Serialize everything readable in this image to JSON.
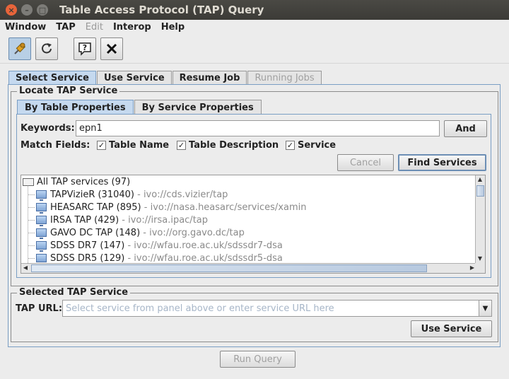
{
  "window": {
    "title": "Table Access Protocol (TAP) Query"
  },
  "menu": {
    "window": "Window",
    "tap": "TAP",
    "edit": "Edit",
    "interop": "Interop",
    "help": "Help"
  },
  "tabs": {
    "select_service": "Select Service",
    "use_service": "Use Service",
    "resume_job": "Resume Job",
    "running_jobs": "Running Jobs"
  },
  "locate": {
    "title": "Locate TAP Service",
    "subtabs": {
      "by_table": "By Table Properties",
      "by_service": "By Service Properties"
    },
    "keywords_label": "Keywords:",
    "keywords_value": "epn1",
    "and_button": "And",
    "match_fields_label": "Match Fields:",
    "match_fields": [
      {
        "label": "Table Name",
        "checked": true
      },
      {
        "label": "Table Description",
        "checked": true
      },
      {
        "label": "Service",
        "checked": true
      }
    ],
    "cancel_button": "Cancel",
    "find_button": "Find Services",
    "tree": {
      "root": "All TAP services (97)",
      "items": [
        {
          "name": "TAPVizieR (31040)",
          "id": "- ivo://cds.vizier/tap"
        },
        {
          "name": "HEASARC TAP (895)",
          "id": "- ivo://nasa.heasarc/services/xamin"
        },
        {
          "name": "IRSA TAP (429)",
          "id": "- ivo://irsa.ipac/tap"
        },
        {
          "name": "GAVO DC TAP (148)",
          "id": "- ivo://org.gavo.dc/tap"
        },
        {
          "name": "SDSS DR7 (147)",
          "id": "- ivo://wfau.roe.ac.uk/sdssdr7-dsa"
        },
        {
          "name": "SDSS DR5 (129)",
          "id": "- ivo://wfau.roe.ac.uk/sdssdr5-dsa"
        }
      ]
    }
  },
  "selected": {
    "title": "Selected TAP Service",
    "url_label": "TAP URL:",
    "url_placeholder": "Select service from panel above or enter service URL here",
    "use_button": "Use Service"
  },
  "run_query_button": "Run Query",
  "icons": {
    "pin": "push-pin-icon",
    "reload": "reload-icon",
    "help": "help-bubble-icon",
    "close": "close-icon"
  }
}
